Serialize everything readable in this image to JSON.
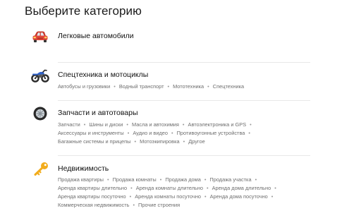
{
  "page": {
    "title": "Выберите категорию"
  },
  "categories": [
    {
      "icon": "car-icon",
      "title": "Легковые автомобили",
      "lines": []
    },
    {
      "icon": "motorcycle-icon",
      "title": "Спецтехника и мотоциклы",
      "lines": [
        [
          "Автобусы и грузовики",
          "Водный транспорт",
          "Мототехника",
          "Спецтехника"
        ]
      ]
    },
    {
      "icon": "tire-icon",
      "title": "Запчасти и автотовары",
      "lines": [
        [
          "Запчасти",
          "Шины и диски",
          "Масла и автохимия",
          "Автоэлектроника и GPS",
          ""
        ],
        [
          "Аксессуары и инструменты",
          "Аудио и видео",
          "Противоугонные устройства",
          ""
        ],
        [
          "Багажные системы и прицепы",
          "Мотоэкипировка",
          "Другое"
        ]
      ]
    },
    {
      "icon": "key-icon",
      "title": "Недвижимость",
      "lines": [
        [
          "Продажа квартиры",
          "Продажа комнаты",
          "Продажа дома",
          "Продажа участка",
          ""
        ],
        [
          "Аренда квартиры длительно",
          "Аренда комнаты длительно",
          "Аренда дома длительно",
          ""
        ],
        [
          "Аренда квартиры посуточно",
          "Аренда комнаты посуточно",
          "Аренда дома посуточно",
          ""
        ],
        [
          "Коммерческая недвижимость",
          "Прочие строения"
        ]
      ]
    }
  ]
}
